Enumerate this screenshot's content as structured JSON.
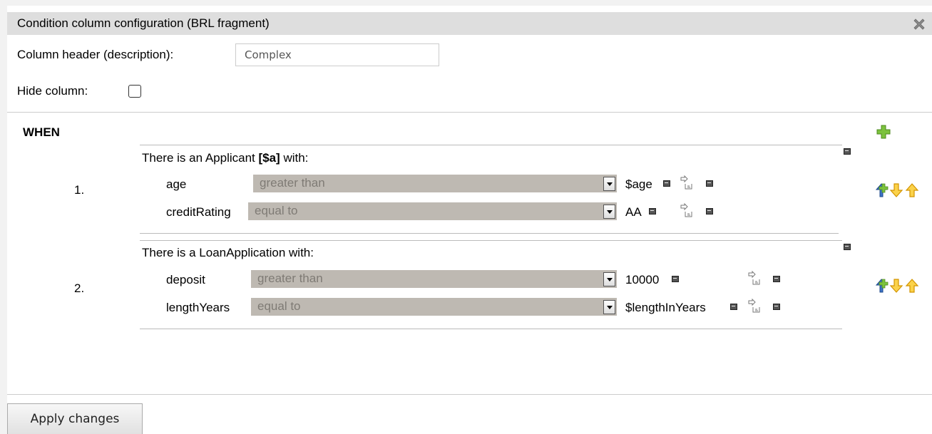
{
  "dialog": {
    "title": "Condition column configuration (BRL fragment)",
    "close_icon": "close-icon"
  },
  "header_field": {
    "label": "Column header (description):",
    "value": "Complex"
  },
  "hide_column": {
    "label": "Hide column:",
    "checked": false
  },
  "rules": {
    "when_label": "WHEN",
    "patterns": [
      {
        "number": "1.",
        "title_prefix": "There is an Applicant ",
        "binding": "[$a]",
        "title_suffix": " with:",
        "constraints": [
          {
            "field": "age",
            "operator": "greater than",
            "value": "$age"
          },
          {
            "field": "creditRating",
            "operator": "equal to",
            "value": "AA"
          }
        ]
      },
      {
        "number": "2.",
        "title": "There is a LoanApplication with:",
        "constraints": [
          {
            "field": "deposit",
            "operator": "greater than",
            "value": "10000"
          },
          {
            "field": "lengthYears",
            "operator": "equal to",
            "value": "$lengthInYears"
          }
        ]
      }
    ]
  },
  "icons": {
    "add": "add-pattern-icon",
    "insert": "insert-icon",
    "move_down": "move-down-icon",
    "move_up": "move-up-icon",
    "remove": "remove-icon",
    "variable": "variable-binding-icon",
    "dropdown": "dropdown-arrow-icon"
  },
  "colors": {
    "titlebar": "#dedede",
    "operator_bg": "#beb9b2",
    "operator_text": "#7f7b75",
    "plus_green": "#7cc23d",
    "arrow_orange": "#f5a800"
  },
  "footer": {
    "apply_label": "Apply changes"
  }
}
